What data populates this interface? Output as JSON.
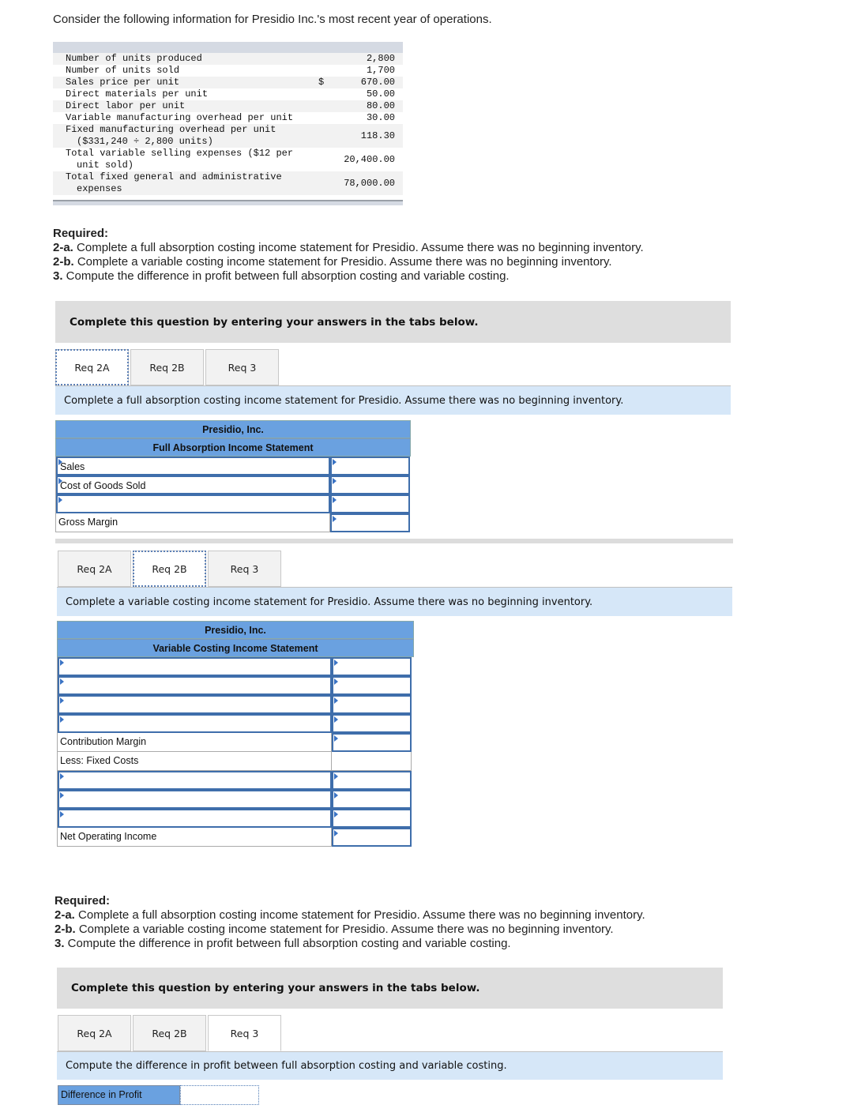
{
  "intro": "Consider the following information for Presidio Inc.'s most recent year of operations.",
  "info_table": [
    {
      "label": "Number of units produced",
      "cont": "",
      "currency": "",
      "value": "2,800"
    },
    {
      "label": "Number of units sold",
      "cont": "",
      "currency": "",
      "value": "1,700"
    },
    {
      "label": "Sales price per unit",
      "cont": "",
      "currency": "$",
      "value": "670.00"
    },
    {
      "label": "Direct materials per unit",
      "cont": "",
      "currency": "",
      "value": "50.00"
    },
    {
      "label": "Direct labor per unit",
      "cont": "",
      "currency": "",
      "value": "80.00"
    },
    {
      "label": "Variable manufacturing overhead per unit",
      "cont": "",
      "currency": "",
      "value": "30.00"
    },
    {
      "label": "Fixed manufacturing overhead per unit",
      "cont": "($331,240 ÷ 2,800 units)",
      "currency": "",
      "value": "118.30"
    },
    {
      "label": "Total variable selling expenses ($12 per",
      "cont": "unit sold)",
      "currency": "",
      "value": "20,400.00"
    },
    {
      "label": "Total fixed general and administrative",
      "cont": "expenses",
      "currency": "",
      "value": "78,000.00"
    }
  ],
  "required": {
    "heading": "Required:",
    "items": [
      {
        "num": "2-a.",
        "text": " Complete a full absorption costing income statement for Presidio. Assume there was no beginning inventory."
      },
      {
        "num": "2-b.",
        "text": " Complete a variable costing income statement for Presidio. Assume there was no beginning inventory."
      },
      {
        "num": "3.",
        "text": " Compute the difference in profit between full absorption costing and variable costing."
      }
    ]
  },
  "banner": "Complete this question by entering your answers in the tabs below.",
  "tabs": [
    "Req 2A",
    "Req 2B",
    "Req 3"
  ],
  "req2a": {
    "instruction": "Complete a full absorption costing income statement for Presidio. Assume there was no beginning inventory.",
    "company": "Presidio, Inc.",
    "title": "Full Absorption Income Statement",
    "rows": [
      {
        "label": "Sales",
        "value": ""
      },
      {
        "label": "Cost of Goods Sold",
        "value": ""
      },
      {
        "label": "",
        "value": ""
      },
      {
        "label": "Gross Margin",
        "value": ""
      }
    ]
  },
  "req2b": {
    "instruction": "Complete a variable costing income statement for Presidio. Assume there was no beginning inventory.",
    "company": "Presidio, Inc.",
    "title": "Variable Costing Income Statement",
    "rows": [
      {
        "label": "",
        "value": ""
      },
      {
        "label": "",
        "value": ""
      },
      {
        "label": "",
        "value": ""
      },
      {
        "label": "",
        "value": ""
      },
      {
        "label": "Contribution Margin",
        "value": ""
      },
      {
        "label": "Less: Fixed Costs",
        "value": ""
      },
      {
        "label": "",
        "value": ""
      },
      {
        "label": "",
        "value": ""
      },
      {
        "label": "",
        "value": ""
      },
      {
        "label": "Net Operating Income",
        "value": ""
      }
    ]
  },
  "req3": {
    "instruction": "Compute the difference in profit between full absorption costing and variable costing.",
    "label": "Difference in Profit",
    "value": ""
  }
}
